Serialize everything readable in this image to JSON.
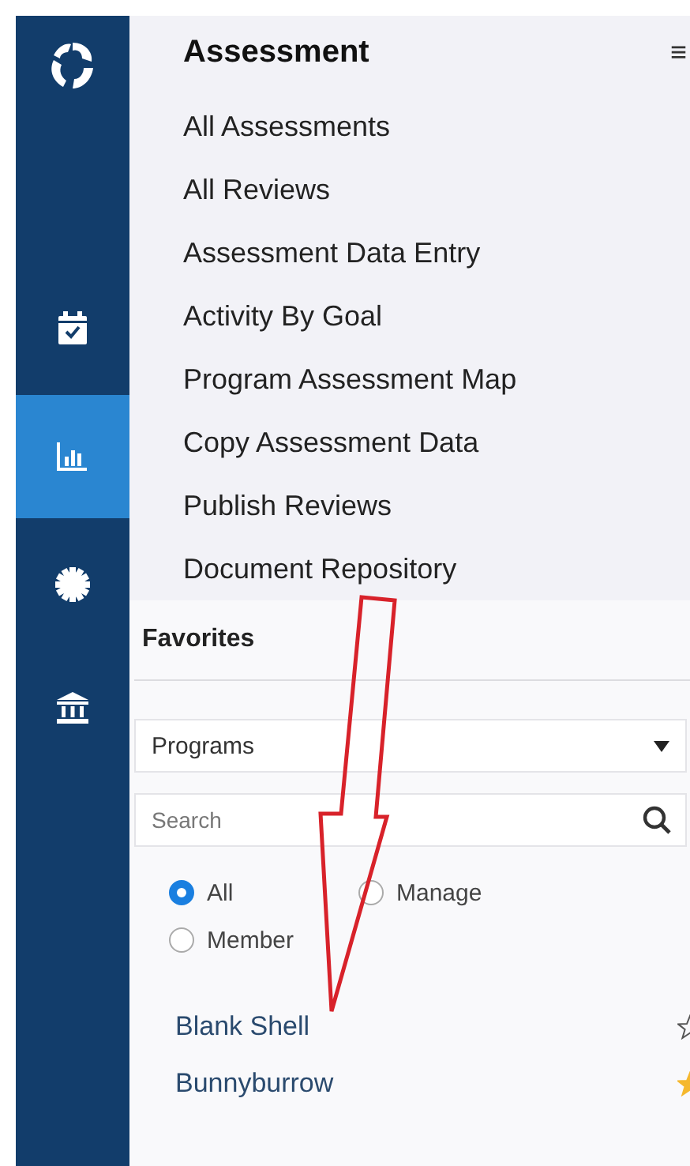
{
  "sidebar": {
    "items": [
      {
        "kind": "calendar",
        "selected": false
      },
      {
        "kind": "chart",
        "selected": true
      },
      {
        "kind": "gear",
        "selected": false
      },
      {
        "kind": "bank",
        "selected": false
      }
    ]
  },
  "menu": {
    "title": "Assessment",
    "toggle": "≡",
    "items": [
      "All Assessments",
      "All Reviews",
      "Assessment Data Entry",
      "Activity By Goal",
      "Program Assessment Map",
      "Copy Assessment Data",
      "Publish Reviews",
      "Document Repository"
    ]
  },
  "favorites": {
    "title": "Favorites",
    "dropdown": "Programs",
    "search": {
      "placeholder": "Search"
    },
    "filters": [
      {
        "label": "All",
        "selected": true
      },
      {
        "label": "Manage",
        "selected": false
      },
      {
        "label": "Member",
        "selected": false
      }
    ],
    "programs": [
      {
        "name": "Blank Shell",
        "starred": false
      },
      {
        "name": "Bunnyburrow",
        "starred": true
      }
    ]
  }
}
